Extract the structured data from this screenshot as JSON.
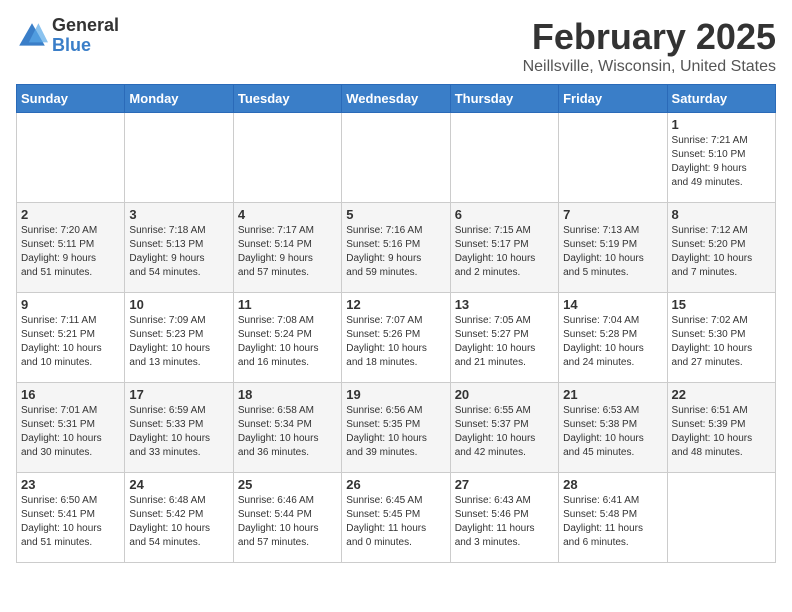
{
  "header": {
    "logo_general": "General",
    "logo_blue": "Blue",
    "month_title": "February 2025",
    "location": "Neillsville, Wisconsin, United States"
  },
  "weekdays": [
    "Sunday",
    "Monday",
    "Tuesday",
    "Wednesday",
    "Thursday",
    "Friday",
    "Saturday"
  ],
  "weeks": [
    [
      {
        "day": "",
        "info": ""
      },
      {
        "day": "",
        "info": ""
      },
      {
        "day": "",
        "info": ""
      },
      {
        "day": "",
        "info": ""
      },
      {
        "day": "",
        "info": ""
      },
      {
        "day": "",
        "info": ""
      },
      {
        "day": "1",
        "info": "Sunrise: 7:21 AM\nSunset: 5:10 PM\nDaylight: 9 hours\nand 49 minutes."
      }
    ],
    [
      {
        "day": "2",
        "info": "Sunrise: 7:20 AM\nSunset: 5:11 PM\nDaylight: 9 hours\nand 51 minutes."
      },
      {
        "day": "3",
        "info": "Sunrise: 7:18 AM\nSunset: 5:13 PM\nDaylight: 9 hours\nand 54 minutes."
      },
      {
        "day": "4",
        "info": "Sunrise: 7:17 AM\nSunset: 5:14 PM\nDaylight: 9 hours\nand 57 minutes."
      },
      {
        "day": "5",
        "info": "Sunrise: 7:16 AM\nSunset: 5:16 PM\nDaylight: 9 hours\nand 59 minutes."
      },
      {
        "day": "6",
        "info": "Sunrise: 7:15 AM\nSunset: 5:17 PM\nDaylight: 10 hours\nand 2 minutes."
      },
      {
        "day": "7",
        "info": "Sunrise: 7:13 AM\nSunset: 5:19 PM\nDaylight: 10 hours\nand 5 minutes."
      },
      {
        "day": "8",
        "info": "Sunrise: 7:12 AM\nSunset: 5:20 PM\nDaylight: 10 hours\nand 7 minutes."
      }
    ],
    [
      {
        "day": "9",
        "info": "Sunrise: 7:11 AM\nSunset: 5:21 PM\nDaylight: 10 hours\nand 10 minutes."
      },
      {
        "day": "10",
        "info": "Sunrise: 7:09 AM\nSunset: 5:23 PM\nDaylight: 10 hours\nand 13 minutes."
      },
      {
        "day": "11",
        "info": "Sunrise: 7:08 AM\nSunset: 5:24 PM\nDaylight: 10 hours\nand 16 minutes."
      },
      {
        "day": "12",
        "info": "Sunrise: 7:07 AM\nSunset: 5:26 PM\nDaylight: 10 hours\nand 18 minutes."
      },
      {
        "day": "13",
        "info": "Sunrise: 7:05 AM\nSunset: 5:27 PM\nDaylight: 10 hours\nand 21 minutes."
      },
      {
        "day": "14",
        "info": "Sunrise: 7:04 AM\nSunset: 5:28 PM\nDaylight: 10 hours\nand 24 minutes."
      },
      {
        "day": "15",
        "info": "Sunrise: 7:02 AM\nSunset: 5:30 PM\nDaylight: 10 hours\nand 27 minutes."
      }
    ],
    [
      {
        "day": "16",
        "info": "Sunrise: 7:01 AM\nSunset: 5:31 PM\nDaylight: 10 hours\nand 30 minutes."
      },
      {
        "day": "17",
        "info": "Sunrise: 6:59 AM\nSunset: 5:33 PM\nDaylight: 10 hours\nand 33 minutes."
      },
      {
        "day": "18",
        "info": "Sunrise: 6:58 AM\nSunset: 5:34 PM\nDaylight: 10 hours\nand 36 minutes."
      },
      {
        "day": "19",
        "info": "Sunrise: 6:56 AM\nSunset: 5:35 PM\nDaylight: 10 hours\nand 39 minutes."
      },
      {
        "day": "20",
        "info": "Sunrise: 6:55 AM\nSunset: 5:37 PM\nDaylight: 10 hours\nand 42 minutes."
      },
      {
        "day": "21",
        "info": "Sunrise: 6:53 AM\nSunset: 5:38 PM\nDaylight: 10 hours\nand 45 minutes."
      },
      {
        "day": "22",
        "info": "Sunrise: 6:51 AM\nSunset: 5:39 PM\nDaylight: 10 hours\nand 48 minutes."
      }
    ],
    [
      {
        "day": "23",
        "info": "Sunrise: 6:50 AM\nSunset: 5:41 PM\nDaylight: 10 hours\nand 51 minutes."
      },
      {
        "day": "24",
        "info": "Sunrise: 6:48 AM\nSunset: 5:42 PM\nDaylight: 10 hours\nand 54 minutes."
      },
      {
        "day": "25",
        "info": "Sunrise: 6:46 AM\nSunset: 5:44 PM\nDaylight: 10 hours\nand 57 minutes."
      },
      {
        "day": "26",
        "info": "Sunrise: 6:45 AM\nSunset: 5:45 PM\nDaylight: 11 hours\nand 0 minutes."
      },
      {
        "day": "27",
        "info": "Sunrise: 6:43 AM\nSunset: 5:46 PM\nDaylight: 11 hours\nand 3 minutes."
      },
      {
        "day": "28",
        "info": "Sunrise: 6:41 AM\nSunset: 5:48 PM\nDaylight: 11 hours\nand 6 minutes."
      },
      {
        "day": "",
        "info": ""
      }
    ]
  ]
}
